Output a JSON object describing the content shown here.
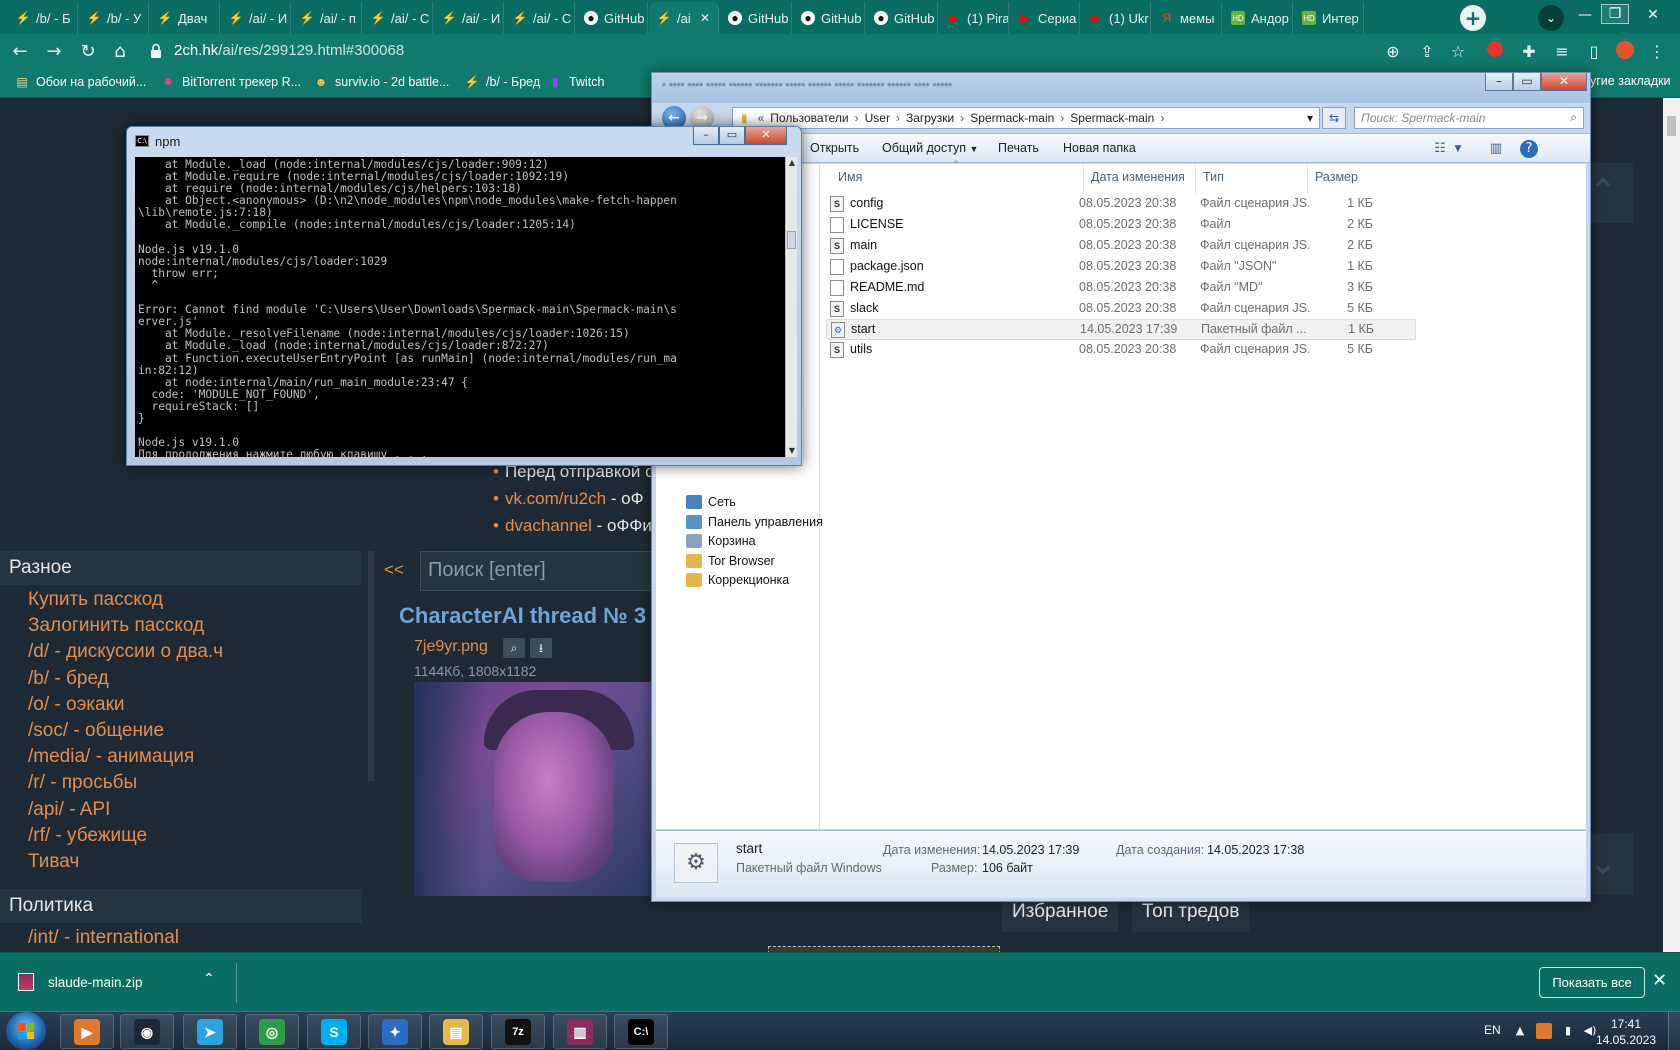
{
  "browser": {
    "tabs": [
      {
        "label": "/b/ - Б",
        "icon": "lightning-icon",
        "color": "#f29b30"
      },
      {
        "label": "/b/ - У",
        "icon": "lightning-icon",
        "color": "#f29b30"
      },
      {
        "label": "Двач",
        "icon": "lightning-icon",
        "color": "#f29b30"
      },
      {
        "label": "/ai/ - И",
        "icon": "lightning-icon",
        "color": "#f29b30"
      },
      {
        "label": "/ai/ - п",
        "icon": "lightning-icon",
        "color": "#f29b30"
      },
      {
        "label": "/ai/ - C",
        "icon": "lightning-icon",
        "color": "#f29b30"
      },
      {
        "label": "/ai/ - И",
        "icon": "lightning-icon",
        "color": "#f29b30"
      },
      {
        "label": "/ai/ - C",
        "icon": "lightning-icon",
        "color": "#f29b30"
      },
      {
        "label": "GitHub",
        "icon": "github-icon",
        "color": "#111111"
      },
      {
        "label": "/ai",
        "icon": "lightning-icon",
        "color": "#f29b30",
        "active": true
      },
      {
        "label": "GitHub",
        "icon": "github-icon",
        "color": "#111111"
      },
      {
        "label": "GitHub",
        "icon": "github-icon",
        "color": "#111111"
      },
      {
        "label": "GitHub",
        "icon": "github-icon",
        "color": "#111111"
      },
      {
        "label": "(1) Pira",
        "icon": "youtube-icon",
        "color": "#ff0000"
      },
      {
        "label": "Сериа",
        "icon": "youtube-icon",
        "color": "#ff0000"
      },
      {
        "label": "(1) Ukr",
        "icon": "youtube-icon",
        "color": "#ff0000"
      },
      {
        "label": "мемы",
        "icon": "yandex-icon",
        "color": "#fc3f1d"
      },
      {
        "label": "Андор",
        "icon": "hd-icon",
        "color": "#6ab03c"
      },
      {
        "label": "Интер",
        "icon": "hd-icon",
        "color": "#6ab03c"
      }
    ],
    "url_domain": "2ch.hk",
    "url_path": "/ai/res/299129.html#300068",
    "bookmarks": [
      {
        "label": "Обои на рабочий...",
        "icon": "folder-icon"
      },
      {
        "label": "BitTorrent трекер R...",
        "icon": "torrent-icon"
      },
      {
        "label": "surviv.io - 2d battle...",
        "icon": "game-icon"
      },
      {
        "label": "/b/ - Бред",
        "icon": "lightning-icon"
      },
      {
        "label": "Twitch",
        "icon": "twitch-icon"
      }
    ],
    "bookmarks_other": "угие закладки"
  },
  "page": {
    "sections": [
      {
        "title": "Разное",
        "links": [
          "Купить пасскод",
          "Залогинить пасскод",
          "/d/ - дискуссии о два.ч",
          "/b/ - бред",
          "/o/ - оэкаки",
          "/soc/ - общение",
          "/media/ - анимация",
          "/r/ - просьбы",
          "/api/ - API",
          "/rf/ - убежище",
          "Тивач"
        ]
      },
      {
        "title": "Политика",
        "links": [
          "/int/ - international"
        ]
      }
    ],
    "rules": [
      {
        "link": "",
        "text": "Перед отправкой с"
      },
      {
        "link": "vk.com/ru2ch",
        "text": " - оФ"
      },
      {
        "link": "dvachannel",
        "text": " - оФФи"
      }
    ],
    "search_collapse": "<<",
    "search_placeholder": "Поиск [enter]",
    "thread_title": "CharacterAI thread № 3",
    "file_name": "7je9yr.png",
    "file_meta": "1144Кб, 1808x1182",
    "bottom_tabs": [
      "Избранное",
      "Топ тредов"
    ]
  },
  "explorer": {
    "breadcrumb": [
      "Пользователи",
      "User",
      "Загрузки",
      "Spermack-main",
      "Spermack-main"
    ],
    "search_placeholder": "Поиск: Spermack-main",
    "commands": [
      "Открыть",
      "Общий доступ",
      "Печать",
      "Новая папка"
    ],
    "columns": [
      "Имя",
      "Дата изменения",
      "Тип",
      "Размер"
    ],
    "nav_items": [
      "Сеть",
      "Панель управления",
      "Корзина",
      "Tor Browser",
      "Коррекционка"
    ],
    "files": [
      {
        "name": "config",
        "date": "08.05.2023 20:38",
        "type": "Файл сценария JS...",
        "size": "1 КБ",
        "kind": "script"
      },
      {
        "name": "LICENSE",
        "date": "08.05.2023 20:38",
        "type": "Файл",
        "size": "2 КБ",
        "kind": "file"
      },
      {
        "name": "main",
        "date": "08.05.2023 20:38",
        "type": "Файл сценария JS...",
        "size": "2 КБ",
        "kind": "script"
      },
      {
        "name": "package.json",
        "date": "08.05.2023 20:38",
        "type": "Файл \"JSON\"",
        "size": "1 КБ",
        "kind": "file"
      },
      {
        "name": "README.md",
        "date": "08.05.2023 20:38",
        "type": "Файл \"MD\"",
        "size": "3 КБ",
        "kind": "file"
      },
      {
        "name": "slack",
        "date": "08.05.2023 20:38",
        "type": "Файл сценария JS...",
        "size": "5 КБ",
        "kind": "script"
      },
      {
        "name": "start",
        "date": "14.05.2023 17:39",
        "type": "Пакетный файл ...",
        "size": "1 КБ",
        "kind": "bat",
        "selected": true
      },
      {
        "name": "utils",
        "date": "08.05.2023 20:38",
        "type": "Файл сценария JS...",
        "size": "5 КБ",
        "kind": "script"
      }
    ],
    "details": {
      "name": "start",
      "kind": "Пакетный файл Windows",
      "modified_label": "Дата изменения:",
      "modified_value": "14.05.2023 17:39",
      "created_label": "Дата создания:",
      "created_value": "14.05.2023 17:38",
      "size_label": "Размер:",
      "size_value": "106 байт"
    }
  },
  "cmd": {
    "title": "npm",
    "output": "    at Module._load (node:internal/modules/cjs/loader:909:12)\n    at Module.require (node:internal/modules/cjs/loader:1092:19)\n    at require (node:internal/modules/cjs/helpers:103:18)\n    at Object.<anonymous> (D:\\n2\\node_modules\\npm\\node_modules\\make-fetch-happen\n\\lib\\remote.js:7:18)\n    at Module._compile (node:internal/modules/cjs/loader:1205:14)\n\nNode.js v19.1.0\nnode:internal/modules/cjs/loader:1029\n  throw err;\n  ^\n\nError: Cannot find module 'C:\\Users\\User\\Downloads\\Spermack-main\\Spermack-main\\s\nerver.js'\n    at Module._resolveFilename (node:internal/modules/cjs/loader:1026:15)\n    at Module._load (node:internal/modules/cjs/loader:872:27)\n    at Function.executeUserEntryPoint [as runMain] (node:internal/modules/run_ma\nin:82:12)\n    at node:internal/main/run_main_module:23:47 {\n  code: 'MODULE_NOT_FOUND',\n  requireStack: []\n}\n\nNode.js v19.1.0\nДля продолжения нажмите любую клавишу . . ."
  },
  "download": {
    "file": "slaude-main.zip",
    "show_all": "Показать все"
  },
  "taskbar": {
    "apps": [
      {
        "icon": "media-player-icon",
        "glyph": "▶",
        "color": "#e0782f"
      },
      {
        "icon": "steam-icon",
        "glyph": "◉",
        "color": "#1b2838"
      },
      {
        "icon": "telegram-icon",
        "glyph": "➤",
        "color": "#2aa3de"
      },
      {
        "icon": "chrome-icon",
        "glyph": "◎",
        "color": "#2f9a4a"
      },
      {
        "icon": "skype-icon",
        "glyph": "S",
        "color": "#00aff0"
      },
      {
        "icon": "network-app-icon",
        "glyph": "✦",
        "color": "#2b6cc4"
      },
      {
        "icon": "explorer-icon",
        "glyph": "▤",
        "color": "#e4b94a"
      },
      {
        "icon": "7zip-icon",
        "glyph": "7z",
        "color": "#111111"
      },
      {
        "icon": "winrar-icon",
        "glyph": "▥",
        "color": "#8a2d5c"
      },
      {
        "icon": "cmd-icon",
        "glyph": "C:\\",
        "color": "#000000"
      }
    ],
    "lang": "EN",
    "time": "17:41",
    "date": "14.05.2023"
  }
}
